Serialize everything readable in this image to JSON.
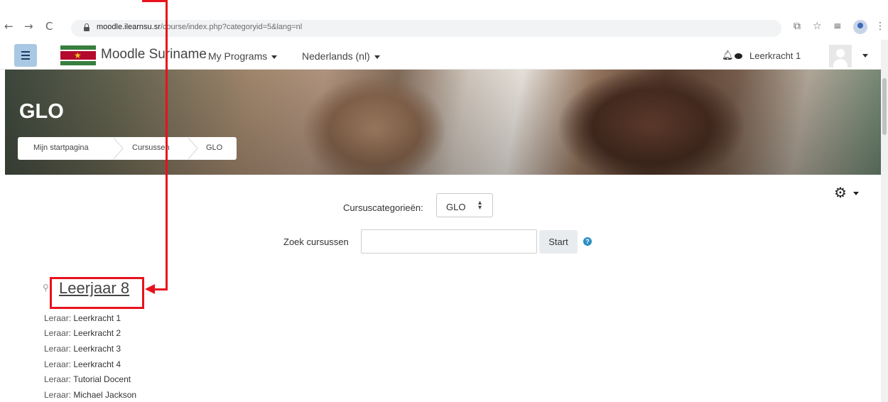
{
  "browser": {
    "back": "←",
    "forward": "→",
    "reload": "C",
    "url_host": "moodle.ilearnsu.sr",
    "url_path": "/course/index.php?categoryid=5&lang=nl",
    "icons": [
      "translate-icon",
      "star-icon",
      "reading-list-icon",
      "profile-icon",
      "menu-icon"
    ]
  },
  "navbar": {
    "site_name": "Moodle Suriname",
    "menu_programs": "My Programs",
    "menu_language": "Nederlands (nl)",
    "user_name": "Leerkracht 1"
  },
  "header": {
    "title": "GLO",
    "breadcrumb": [
      "Mijn startpagina",
      "Cursussen",
      "GLO"
    ]
  },
  "category_select": {
    "label": "Cursuscategorieën:",
    "value": "GLO"
  },
  "search": {
    "label": "Zoek cursussen",
    "value": "",
    "button": "Start"
  },
  "course": {
    "name": "Leerjaar 8",
    "role_label": "Leraar:",
    "teachers": [
      "Leerkracht 1",
      "Leerkracht 2",
      "Leerkracht 3",
      "Leerkracht 4",
      "Tutorial Docent",
      "Michael Jackson"
    ]
  },
  "colors": {
    "annotation": "#e8121c",
    "hamburger": "#a9c8e3",
    "help": "#2b8ec6"
  }
}
